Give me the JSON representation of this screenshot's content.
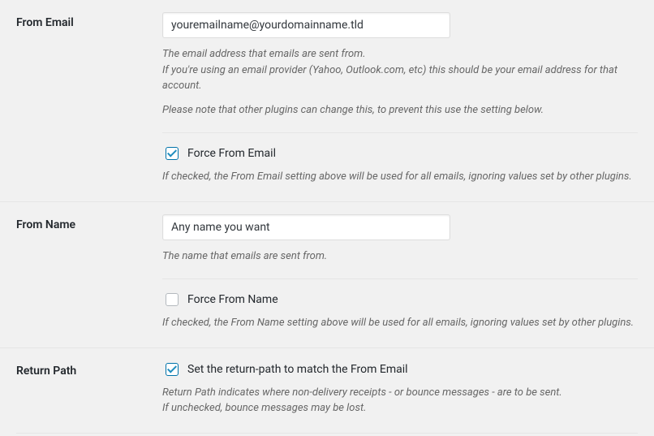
{
  "fromEmail": {
    "label": "From Email",
    "value": "youremailname@yourdomainname.tld",
    "desc1": "The email address that emails are sent from.",
    "desc2": "If you're using an email provider (Yahoo, Outlook.com, etc) this should be your email address for that account.",
    "desc3": "Please note that other plugins can change this, to prevent this use the setting below.",
    "forceLabel": "Force From Email",
    "forceChecked": true,
    "forceDesc": "If checked, the From Email setting above will be used for all emails, ignoring values set by other plugins."
  },
  "fromName": {
    "label": "From Name",
    "value": "Any name you want",
    "desc": "The name that emails are sent from.",
    "forceLabel": "Force From Name",
    "forceChecked": false,
    "forceDesc": "If checked, the From Name setting above will be used for all emails, ignoring values set by other plugins."
  },
  "returnPath": {
    "label": "Return Path",
    "checkLabel": "Set the return-path to match the From Email",
    "checked": true,
    "desc1": "Return Path indicates where non-delivery receipts - or bounce messages - are to be sent.",
    "desc2": "If unchecked, bounce messages may be lost."
  }
}
